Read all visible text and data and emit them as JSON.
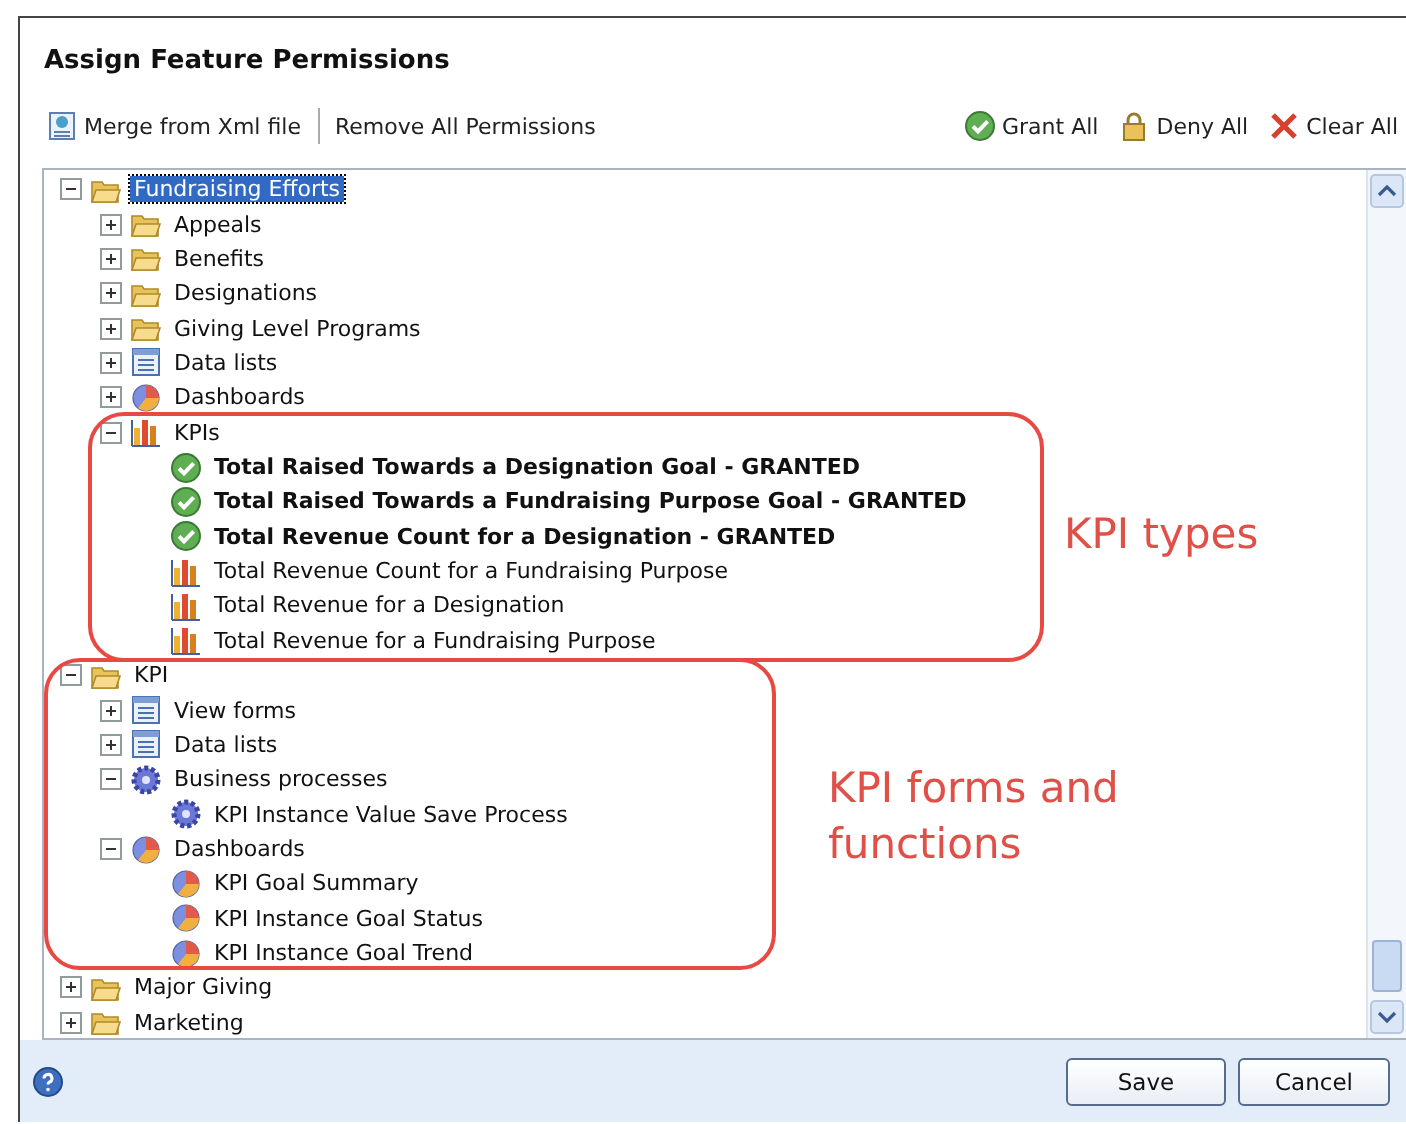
{
  "window": {
    "title": "Assign Feature Permissions"
  },
  "toolbar": {
    "left": [
      {
        "label": "Merge from Xml file",
        "kind": "merge"
      },
      {
        "label": "Remove All Permissions",
        "kind": "plain"
      }
    ],
    "right": [
      {
        "label": "Grant All",
        "kind": "grant"
      },
      {
        "label": "Deny All",
        "kind": "deny"
      },
      {
        "label": "Clear All",
        "kind": "clear"
      }
    ]
  },
  "tree": [
    {
      "label": "Fundraising Efforts",
      "kind": "folder",
      "expanded": true,
      "selected": true,
      "children": [
        {
          "label": "Appeals",
          "kind": "folder",
          "expanded": false,
          "selected": false
        },
        {
          "label": "Benefits",
          "kind": "folder",
          "expanded": false,
          "selected": false
        },
        {
          "label": "Designations",
          "kind": "folder",
          "expanded": false,
          "selected": false
        },
        {
          "label": "Giving Level Programs",
          "kind": "folder",
          "expanded": false,
          "selected": false
        },
        {
          "label": "Data lists",
          "kind": "datalist",
          "expanded": false,
          "selected": false
        },
        {
          "label": "Dashboards",
          "kind": "dashboard",
          "expanded": false,
          "selected": false
        },
        {
          "label": "KPIs",
          "kind": "kpi",
          "expanded": true,
          "selected": false,
          "children": [
            {
              "label": "Total Raised Towards a Designation Goal - GRANTED",
              "kind": "granted",
              "selected": false
            },
            {
              "label": "Total Raised Towards a Fundraising Purpose Goal - GRANTED",
              "kind": "granted",
              "selected": false
            },
            {
              "label": "Total Revenue Count for a Designation - GRANTED",
              "kind": "granted",
              "selected": false
            },
            {
              "label": "Total Revenue Count for a Fundraising Purpose",
              "kind": "kpi",
              "selected": false
            },
            {
              "label": "Total Revenue for a Designation",
              "kind": "kpi",
              "selected": false
            },
            {
              "label": "Total Revenue for a Fundraising Purpose",
              "kind": "kpi",
              "selected": false
            }
          ]
        }
      ]
    },
    {
      "label": "KPI",
      "kind": "folder",
      "expanded": true,
      "selected": false,
      "children": [
        {
          "label": "View forms",
          "kind": "viewform",
          "expanded": false,
          "selected": false
        },
        {
          "label": "Data lists",
          "kind": "datalist",
          "expanded": false,
          "selected": false
        },
        {
          "label": "Business processes",
          "kind": "process",
          "expanded": true,
          "selected": false,
          "children": [
            {
              "label": "KPI Instance Value Save Process",
              "kind": "process",
              "selected": false
            }
          ]
        },
        {
          "label": "Dashboards",
          "kind": "dashboard",
          "expanded": true,
          "selected": false,
          "children": [
            {
              "label": "KPI Goal Summary",
              "kind": "dashboard",
              "selected": false
            },
            {
              "label": "KPI Instance Goal Status",
              "kind": "dashboard",
              "selected": false
            },
            {
              "label": "KPI Instance Goal Trend",
              "kind": "dashboard",
              "selected": false
            }
          ]
        }
      ]
    },
    {
      "label": "Major Giving",
      "kind": "folder",
      "expanded": false,
      "selected": false
    },
    {
      "label": "Marketing",
      "kind": "folder",
      "expanded": false,
      "selected": false
    }
  ],
  "annotations": [
    {
      "label": "KPI types"
    },
    {
      "label": "KPI forms and functions"
    }
  ],
  "buttons": [
    {
      "label": "Save"
    },
    {
      "label": "Cancel"
    }
  ]
}
